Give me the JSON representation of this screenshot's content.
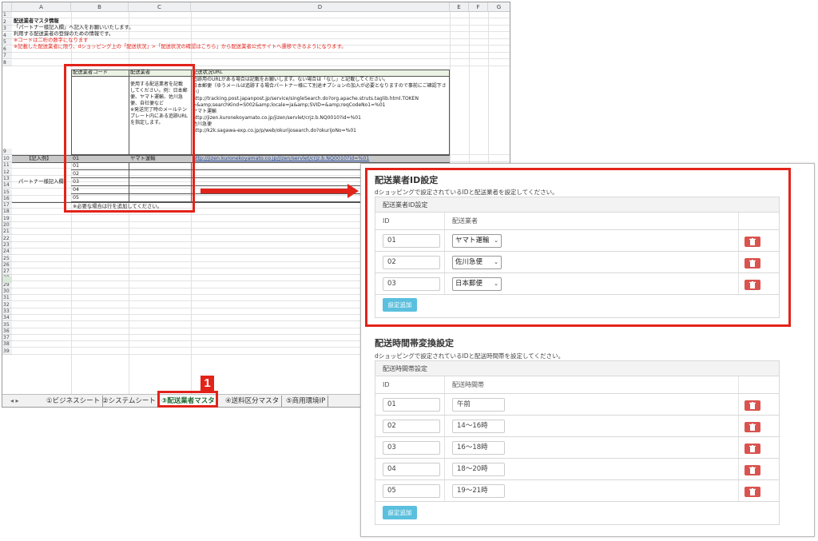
{
  "spreadsheet": {
    "columns": [
      "A",
      "B",
      "C",
      "D",
      "E",
      "F",
      "G"
    ],
    "rows": [
      "1",
      "2",
      "3",
      "4",
      "5",
      "6",
      "7",
      "8",
      "9",
      "10",
      "11",
      "12",
      "13",
      "14",
      "15",
      "16",
      "17",
      "18",
      "19",
      "20",
      "21",
      "22",
      "23",
      "24",
      "25",
      "26",
      "27",
      "28",
      "29",
      "30",
      "31",
      "32",
      "33",
      "34",
      "35",
      "36",
      "37",
      "38",
      "39"
    ],
    "title": "配送業者マスタ情報",
    "line3": "「パートナー様記入欄」へ記入をお願いいたします。",
    "line4": "利用する配送業者の登録のための情報です。",
    "line5": "※コードは二桁の数字になります",
    "line6": "※記載した配送業者に限り、dショッピング上の「配送状況」>「配送状況の確認はこちら」から配送業者公式サイトへ遷移できるようになります。",
    "header_code": "配送業者コード",
    "header_carrier": "配送業者",
    "header_url": "配送状況URL",
    "carrier_note": [
      "使用する配送業者を記載",
      "してください。例：日本郵",
      "便、ヤマト運輸、佐川急",
      "便、自社便など",
      "",
      "※発送完了時のメールテン",
      "プレート内にある追跡URL",
      "を指定します。"
    ],
    "url_note": [
      "追跡用のURLがある場合は記載をお願いします。ない場合は「なし」と記載してください。",
      "日本郵便（ゆうメールは追跡する場合パートナー様にて別途オプションの加入が必要となりますので事前にご確認下さ",
      "い）",
      "http://tracking.post.japanpost.jp/service/singleSearch.do?org.apache.struts.taglib.html.TOKEN",
      "=&amp;searchKind=S002&amp;locale=ja&amp;SVID=&amp;reqCodeNo1=%01",
      "ヤマト運輸",
      "http://jizen.kuronekoyamato.co.jp/jizen/servlet/crjz.b.NQ0010?id=%01",
      "佐川急便",
      "http://k2k.sagawa-exp.co.jp/p/web/okurijosearch.do?okurijoNo=%01"
    ],
    "example_label": "【記入例】",
    "example_code": "01",
    "example_carrier": "ヤマト運輸",
    "example_url": "http://jizen.kuronekoyamato.co.jp/jizen/servlet/crjz.b.NQ0010?id=%01",
    "partner_label": "パートナー様記入欄",
    "codes": [
      "01",
      "02",
      "03",
      "04",
      "05"
    ],
    "add_rows_note": "※必要な場合は行を追加してください。",
    "tabs": [
      "①ビジネスシート",
      "②システムシート",
      "③配送業者マスタ",
      "④送料区分マスタ",
      "⑤商用環境IP"
    ],
    "tab_nav": "◂  ▸"
  },
  "badge": "1",
  "panel": {
    "section1": {
      "title": "配送業者ID設定",
      "desc": "dショッピングで設定されているIDと配送業者を設定してください。",
      "card_title": "配送業者ID設定",
      "col_id": "ID",
      "col_name": "配送業者",
      "rows": [
        {
          "id": "01",
          "name": "ヤマト運輸"
        },
        {
          "id": "02",
          "name": "佐川急便"
        },
        {
          "id": "03",
          "name": "日本郵便"
        }
      ],
      "add_button": "設定追加"
    },
    "section2": {
      "title": "配送時間帯変換設定",
      "desc": "dショッピングで設定されているIDと配送時間帯を設定してください。",
      "card_title": "配送時間帯設定",
      "col_id": "ID",
      "col_name": "配送時間帯",
      "rows": [
        {
          "id": "01",
          "name": "午前"
        },
        {
          "id": "02",
          "name": "14〜16時"
        },
        {
          "id": "03",
          "name": "16〜18時"
        },
        {
          "id": "04",
          "name": "18〜20時"
        },
        {
          "id": "05",
          "name": "19〜21時"
        }
      ],
      "add_button": "設定追加"
    }
  },
  "colors": {
    "accent_red": "#e2231a",
    "add_button": "#5bc0de",
    "delete_button": "#d9534f",
    "header_fill": "#ebf3e4"
  }
}
